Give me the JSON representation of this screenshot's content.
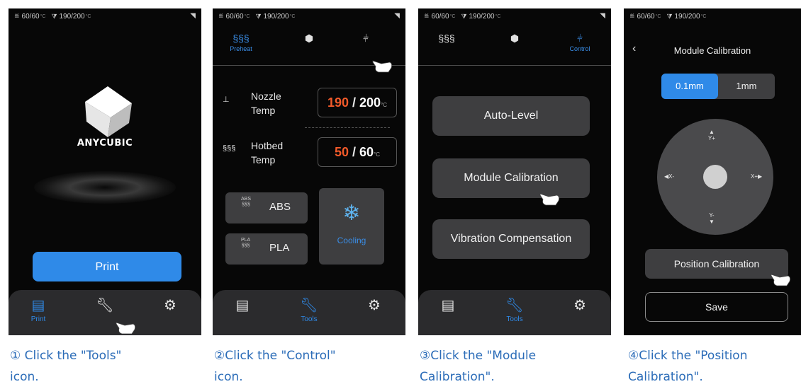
{
  "status": {
    "bed": "60/60",
    "nozzle": "190/200",
    "deg_unit": "°C"
  },
  "screen1": {
    "brand": "ANYCUBIC",
    "print_button": "Print",
    "nav": [
      "Print",
      "",
      ""
    ]
  },
  "screen2": {
    "tabs": [
      "Preheat",
      "",
      ""
    ],
    "nozzle_label": "Nozzle Temp",
    "nozzle_current": "190",
    "nozzle_target": "200",
    "hotbed_label": "Hotbed Temp",
    "hotbed_current": "50",
    "hotbed_target": "60",
    "unit": "°C",
    "abs_small": "ABS",
    "abs_label": "ABS",
    "pla_small": "PLA",
    "pla_label": "PLA",
    "cooling_label": "Cooling",
    "nav": [
      "",
      "Tools",
      ""
    ]
  },
  "screen3": {
    "tabs": [
      "",
      "",
      "Control"
    ],
    "buttons": [
      "Auto-Level",
      "Module Calibration",
      "Vibration Compensation"
    ],
    "nav": [
      "",
      "Tools",
      ""
    ]
  },
  "screen4": {
    "back_icon": "‹",
    "title": "Module Calibration",
    "step_options": [
      "0.1mm",
      "1mm"
    ],
    "dirs": {
      "up": "Y+",
      "down": "Y-",
      "left": "X-",
      "right": "X+"
    },
    "position_button": "Position Calibration",
    "save_button": "Save"
  },
  "captions": [
    [
      "① Click the \"Tools\"",
      "icon."
    ],
    [
      "②Click the \"Control\"",
      "icon."
    ],
    [
      "③Click the \"Module",
      "Calibration\"."
    ],
    [
      "④Click the \"Position",
      "Calibration\"."
    ]
  ],
  "colors": {
    "accent": "#2f8ae8",
    "caption": "#2b6cb8",
    "nozzle_current": "#f25a2a",
    "cooling_icon": "#5fb4f0"
  },
  "icons": [
    "heater-icon",
    "nozzle-icon",
    "wifi-icon",
    "file-icon",
    "wrench-icon",
    "gear-icon",
    "preheat-icon",
    "fan-icon",
    "control-icon",
    "snowflake-icon",
    "hand-pointer-icon"
  ]
}
